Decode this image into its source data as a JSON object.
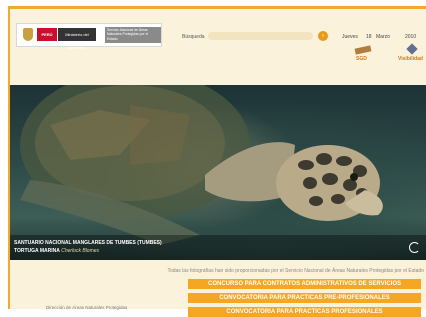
{
  "header": {
    "peru_label": "PERÚ",
    "ministerio_label": "Ministerio del Ambiente",
    "servicio_label": "Servicio Nacional de Áreas Naturales Protegidas por el Estado",
    "search_label": "Búsqueda",
    "search_value": "",
    "date": {
      "weekday": "Jueves",
      "day": "18",
      "month": "Marzo",
      "year": "2010"
    },
    "sgd_label": "SGD",
    "visibilidad_label": "Visibilidad"
  },
  "hero": {
    "title": "SANTUARIO NACIONAL MANGLARES DE TUMBES (TUMBES)",
    "subtitle_prefix": "TORTUGA MARINA",
    "author": "Cherlock Blomes"
  },
  "credit": "Todas las fotografías han sido proporcionadas por el Servicio Nacional de Áreas Naturales Protegidas por el Estado",
  "buttons": [
    "CONCURSO PARA CONTRATOS ADMINISTRATIVOS DE SERVICIOS",
    "CONVOCATORIA PARA PRACTICAS PRE-PROFESIONALES",
    "CONVOCATORIA PARA PRACTICAS PROFESIONALES"
  ],
  "left_link": "Dirección de Áreas Naturales Protegidas"
}
